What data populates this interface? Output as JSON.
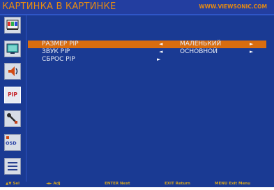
{
  "header": {
    "title": "КАРТИНКА В КАРТИНКЕ",
    "website": "WWW.VIEWSONIC.COM"
  },
  "sidebar": {
    "items": [
      {
        "name": "color-icon",
        "selected": false
      },
      {
        "name": "screen-icon",
        "selected": false
      },
      {
        "name": "audio-icon",
        "selected": false
      },
      {
        "name": "pip-icon",
        "label": "PIP",
        "selected": true
      },
      {
        "name": "setup-tool-icon",
        "selected": false
      },
      {
        "name": "osd-icon",
        "label": "OSD",
        "selected": false
      },
      {
        "name": "menu-list-icon",
        "selected": false
      }
    ]
  },
  "menu": {
    "rows": [
      {
        "label": "РАЗМЕР PIP",
        "left_arrow": "◄",
        "value": "МАЛЕНЬКИЙ",
        "right_arrow": "►",
        "selected": true
      },
      {
        "label": "ЗВУК PIP",
        "left_arrow": "◄",
        "value": "ОСНОВНОЙ",
        "right_arrow": "►",
        "selected": false
      },
      {
        "label": "СБРОС PIP",
        "enter_arrow": "►",
        "selected": false
      }
    ]
  },
  "footer": {
    "hints": [
      {
        "key": "▲▼",
        "label": "Sel"
      },
      {
        "key": "◄►",
        "label": "Adj"
      },
      {
        "key": "ENTER",
        "label": "Next"
      },
      {
        "key": "EXIT",
        "label": "Return"
      },
      {
        "key": "MENU",
        "label": "Exit Menu"
      }
    ]
  },
  "colors": {
    "background": "#1a3a93",
    "title": "#e58a12",
    "selected_row": "#d96d0f",
    "hint_text": "#d7a720"
  }
}
